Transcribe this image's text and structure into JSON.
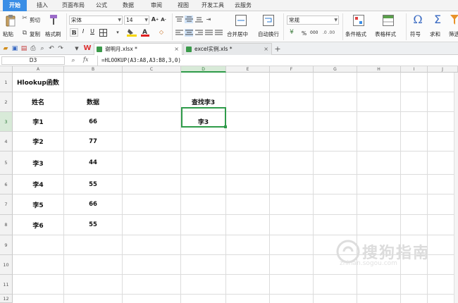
{
  "menu_tabs": [
    "开始",
    "插入",
    "页面布局",
    "公式",
    "数据",
    "审阅",
    "视图",
    "开发工具",
    "云服务"
  ],
  "ribbon": {
    "paste": "粘贴",
    "cut": "剪切",
    "copy": "复制",
    "format_painter": "格式刷",
    "font_name": "宋体",
    "font_size": "14",
    "bold": "B",
    "italic": "I",
    "underline": "U",
    "merge_center": "合并居中",
    "wrap_text": "自动换行",
    "number_format": "常规",
    "cond_format": "条件格式",
    "table_style": "表格样式",
    "symbol": "符号",
    "sum": "求和",
    "filter": "筛选",
    "pct": "%",
    "thousand": "000"
  },
  "file_tabs": [
    {
      "label": "谢明月.xlsx *"
    },
    {
      "label": "excel实例.xls *"
    }
  ],
  "formula_bar": {
    "cell_ref": "D3",
    "fx": "fx",
    "formula": "=HLOOKUP(A3:A8,A3:B8,3,0)"
  },
  "columns": [
    "A",
    "B",
    "C",
    "D",
    "E",
    "F",
    "G",
    "H",
    "I",
    "J"
  ],
  "rows": [
    "1",
    "2",
    "3",
    "4",
    "5",
    "6",
    "7",
    "8",
    "9",
    "10",
    "11",
    "12"
  ],
  "cells": {
    "A1": "Hlookup函数",
    "A2": "姓名",
    "B2": "数据",
    "D2": "查找李3",
    "A3": "李1",
    "B3": "66",
    "D3": "李3",
    "A4": "李2",
    "B4": "77",
    "A5": "李3",
    "B5": "44",
    "A6": "李4",
    "B6": "55",
    "A7": "李5",
    "B7": "66",
    "A8": "李6",
    "B8": "55"
  },
  "watermark": {
    "text": "搜狗指南",
    "url": "zhinan.sogou.com"
  },
  "colors": {
    "accent": "#3a8ee6",
    "selection": "#2f9b4a",
    "tab_active": "#ffffff"
  }
}
